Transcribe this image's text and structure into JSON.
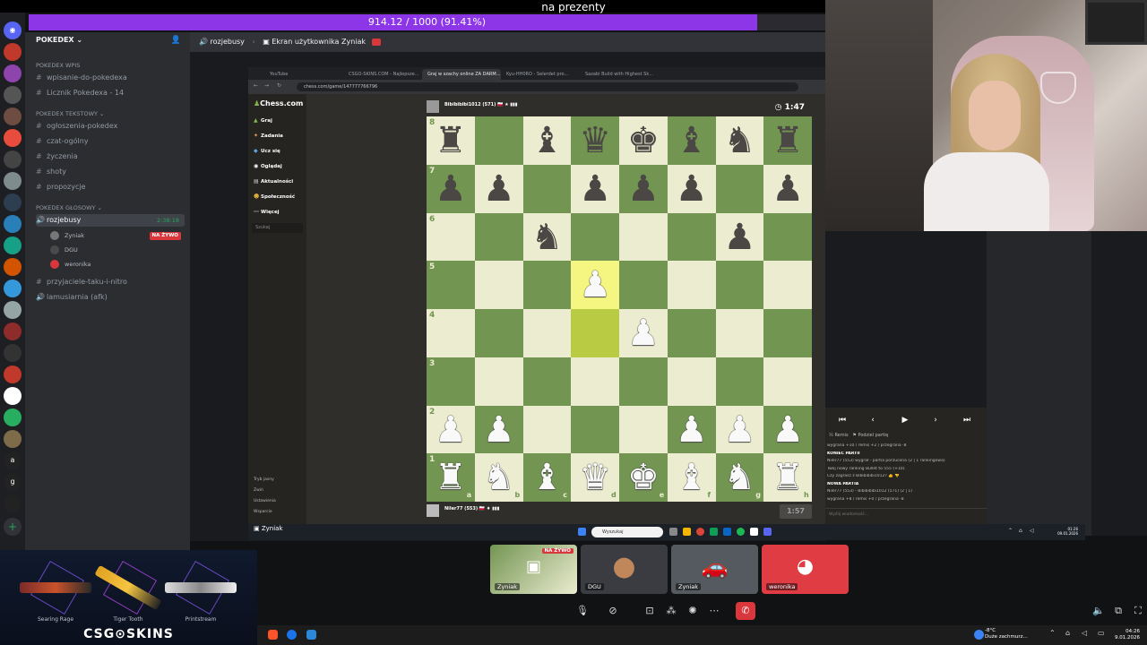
{
  "goal": {
    "title": "na prezenty",
    "progress_text": "914.12 / 1000 (91.41%)",
    "progress_fraction": 0.9141
  },
  "sidebar": {
    "server_name": "POKEDEX ⌄",
    "cat1": "POKEDEX Wpis",
    "ch_wpisanie": "wpisanie-do-pokedexa",
    "ch_licznik": "Licznik Pokedexa - 14",
    "cat2": "POKEDEX Tekstowy ⌄",
    "ch_ogloszenia": "ogłoszenia-pokedex",
    "ch_czat": "czat-ogólny",
    "ch_zyczenia": "życzenia",
    "ch_shoty": "shoty",
    "ch_propozycje": "propozycje",
    "cat3": "POKEDEX GŁOSOWY ⌄",
    "voice_channel": "rozjebusy",
    "voice_time": "2:38:18",
    "voice_users": [
      "Zyniak",
      "DGU",
      "weronika"
    ],
    "live_label": "NA ŻYWO",
    "ch_przyjaciele": "przyjaciele-taku-i-nitro",
    "ch_lamusiarnia": "lamusiarnia (afk)"
  },
  "header": {
    "channel": "rozjebusy",
    "stream_title": "Ekran użytkownika Zyniak"
  },
  "browser": {
    "tabs": [
      "YouTube",
      "CSGO-SKINS.COM - Najlepsze...",
      "Graj w szachy online ZA DARM...",
      "Kyu-HH0RO - Selerdet pro...",
      "Sazabi Build with Highest Sk..."
    ],
    "url": "chess.com/game/147777766796"
  },
  "chess_nav": {
    "logo": "Chess.com",
    "items": [
      "Graj",
      "Zadania",
      "Ucz się",
      "Oglądaj",
      "Aktualności",
      "Społeczność",
      "Więcej"
    ],
    "search_placeholder": "Szukaj",
    "bottom": [
      "Tryb jasny",
      "Zwiń",
      "Ustawienia",
      "Wsparcie"
    ]
  },
  "players": {
    "top_name": "Bibibibibi1012 (571) 🇵🇱 ★ ▮▮▮",
    "top_clock": "1:47",
    "bottom_name": "Niler77 (553) 🇵🇱 ♦ ▮▮▮",
    "bottom_clock": "1:57"
  },
  "board": {
    "ranks": [
      "8",
      "7",
      "6",
      "5",
      "4",
      "3",
      "2",
      "1"
    ],
    "files": [
      "a",
      "b",
      "c",
      "d",
      "e",
      "f",
      "g",
      "h"
    ],
    "pieces": [
      {
        "sq": "a8",
        "p": "♜",
        "c": "b"
      },
      {
        "sq": "c8",
        "p": "♝",
        "c": "b"
      },
      {
        "sq": "d8",
        "p": "♛",
        "c": "b"
      },
      {
        "sq": "e8",
        "p": "♚",
        "c": "b"
      },
      {
        "sq": "f8",
        "p": "♝",
        "c": "b"
      },
      {
        "sq": "g8",
        "p": "♞",
        "c": "b"
      },
      {
        "sq": "h8",
        "p": "♜",
        "c": "b"
      },
      {
        "sq": "a7",
        "p": "♟",
        "c": "b"
      },
      {
        "sq": "b7",
        "p": "♟",
        "c": "b"
      },
      {
        "sq": "d7",
        "p": "♟",
        "c": "b"
      },
      {
        "sq": "e7",
        "p": "♟",
        "c": "b"
      },
      {
        "sq": "f7",
        "p": "♟",
        "c": "b"
      },
      {
        "sq": "h7",
        "p": "♟",
        "c": "b"
      },
      {
        "sq": "c6",
        "p": "♞",
        "c": "b"
      },
      {
        "sq": "g6",
        "p": "♟",
        "c": "b"
      },
      {
        "sq": "d5",
        "p": "♟",
        "c": "w"
      },
      {
        "sq": "e4",
        "p": "♟",
        "c": "w"
      },
      {
        "sq": "a2",
        "p": "♟",
        "c": "w"
      },
      {
        "sq": "b2",
        "p": "♟",
        "c": "w"
      },
      {
        "sq": "f2",
        "p": "♟",
        "c": "w"
      },
      {
        "sq": "g2",
        "p": "♟",
        "c": "w"
      },
      {
        "sq": "h2",
        "p": "♟",
        "c": "w"
      },
      {
        "sq": "a1",
        "p": "♜",
        "c": "w"
      },
      {
        "sq": "b1",
        "p": "♞",
        "c": "w"
      },
      {
        "sq": "c1",
        "p": "♝",
        "c": "w"
      },
      {
        "sq": "d1",
        "p": "♛",
        "c": "w"
      },
      {
        "sq": "e1",
        "p": "♚",
        "c": "w"
      },
      {
        "sq": "f1",
        "p": "♝",
        "c": "w"
      },
      {
        "sq": "g1",
        "p": "♞",
        "c": "w"
      },
      {
        "sq": "h1",
        "p": "♜",
        "c": "w"
      }
    ],
    "highlight": [
      "d5",
      "d4"
    ]
  },
  "panel": {
    "opt_remis": "Remis",
    "opt_podaj": "Podziel partię",
    "chat": [
      {
        "t": "wygrana +10 / remis +2 / przegrana -8",
        "b": false
      },
      {
        "t": "KONIEC PARTII",
        "b": true
      },
      {
        "t": "Niler77 (553) wygrał - partia porzucona (2 | 1 rankingowa)",
        "b": false
      },
      {
        "t": "Twój nowy ranking Bullet to 555 (+10).",
        "b": false
      },
      {
        "t": "Czy zagrasz z Bibibibibi1012? 👍 👎",
        "b": false
      },
      {
        "t": "NOWA PARTIA",
        "b": true
      },
      {
        "t": "Niler77 (553) - Bibibibibi1012 (571) (2 | 1)",
        "b": false
      },
      {
        "t": "wygrana +8 / remis +0 / przegrana -8",
        "b": false
      }
    ],
    "chat_placeholder": "Wyślij wiadomość..."
  },
  "win_taskbar": {
    "search": "Wyszukaj",
    "share_label": "Zyniak",
    "clock_time": "01:26",
    "clock_date": "09.01.2026"
  },
  "tiles": [
    {
      "name": "Zyniak",
      "live": "NA ŻYWO"
    },
    {
      "name": "DGU"
    },
    {
      "name": "Zyniak"
    },
    {
      "name": "weronika"
    }
  ],
  "csg": {
    "skins": [
      "Searing Rage",
      "Tiger Tooth",
      "Printstream"
    ],
    "logo": "CSG⊙SKINS"
  },
  "os": {
    "weather_temp": "-8°C",
    "weather_desc": "Duże zachmurz...",
    "clock_time": "04:26",
    "clock_date": "9.01.2026"
  }
}
